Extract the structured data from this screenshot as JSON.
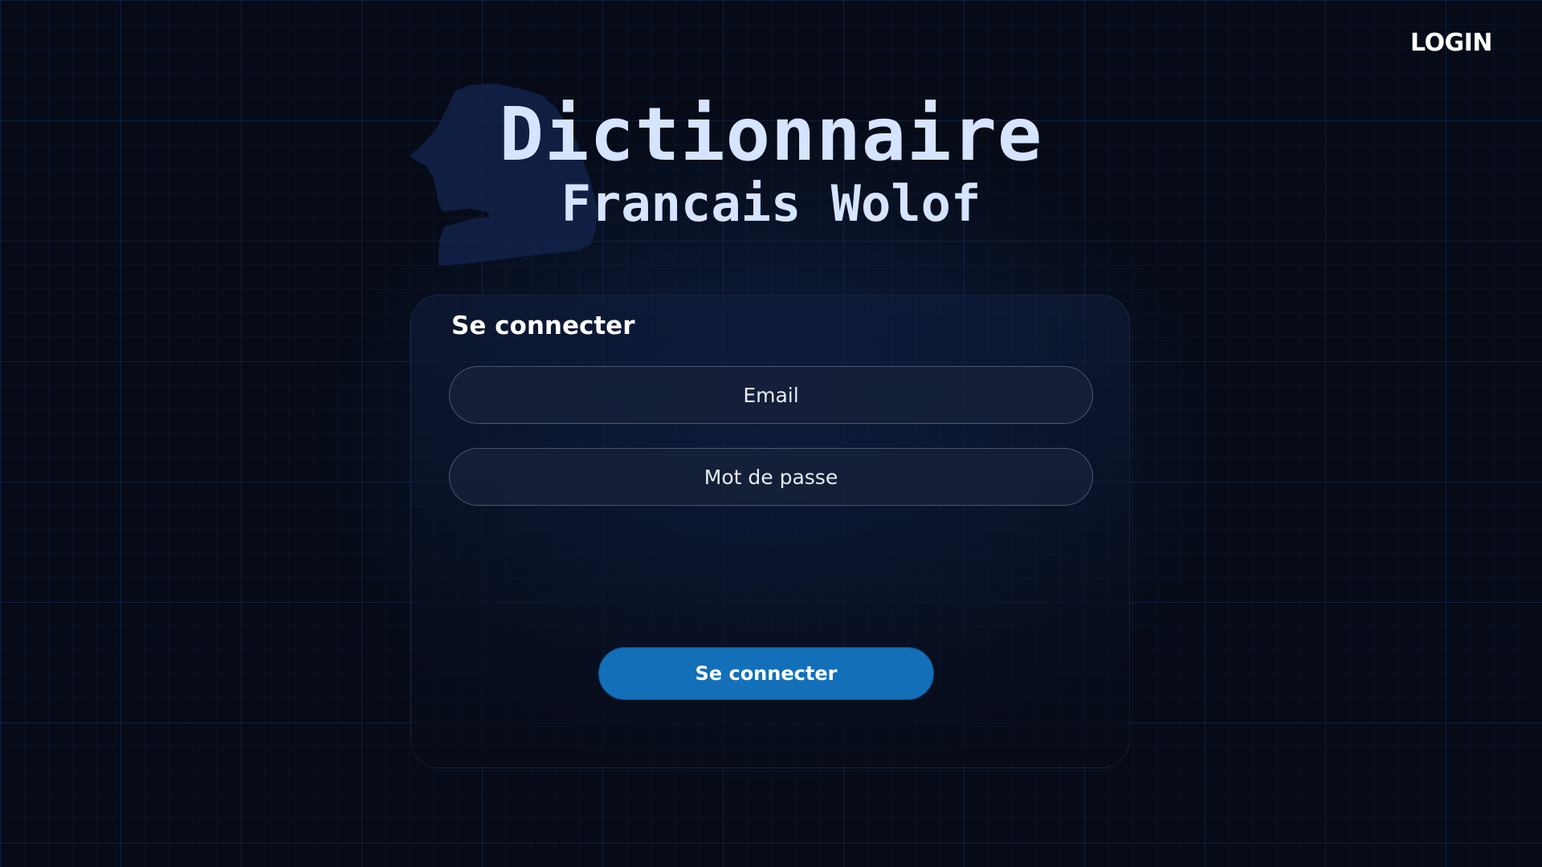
{
  "nav": {
    "login_label": "LOGIN"
  },
  "header": {
    "title": "Dictionnaire",
    "subtitle": "Francais Wolof",
    "map_icon": "senegal-map-silhouette"
  },
  "login_form": {
    "heading": "Se connecter",
    "email_placeholder": "Email",
    "password_placeholder": "Mot de passe",
    "submit_label": "Se connecter"
  },
  "colors": {
    "background": "#060b17",
    "title_text": "#d6e4ff",
    "primary_button": "#1370b8",
    "map_silhouette": "#13224a"
  }
}
